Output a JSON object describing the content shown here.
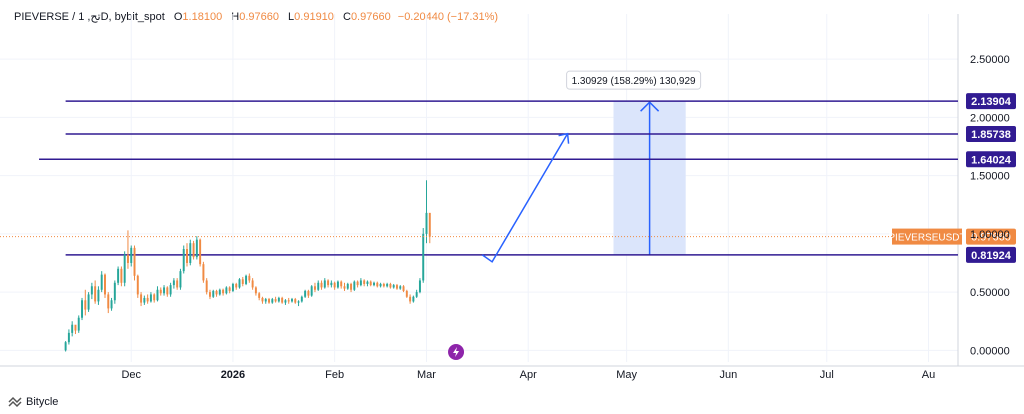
{
  "header": {
    "symbol": "PIEVERSE / 1 ,تحD, bybit_spot",
    "o_label": "O",
    "o_value": "1.18100",
    "h_label": "H",
    "h_value": "0.97660",
    "l_label": "L",
    "l_value": "0.91910",
    "c_label": "C",
    "c_value": "0.97660",
    "change": "−0.20440 (−17.31%)"
  },
  "footer": {
    "brand": "Bitycle"
  },
  "colors": {
    "up": "#26a69a",
    "down": "#f08a43",
    "level": "#311b92",
    "price_tag": "#f08a43",
    "range_fill": "#dbe5fb",
    "arrow": "#2962ff"
  },
  "chart_data": {
    "type": "candlestick",
    "ylim": [
      -0.1,
      2.75
    ],
    "y_ticks": [
      "0.00000",
      "0.50000",
      "1.00000",
      "1.50000",
      "2.00000",
      "2.50000"
    ],
    "y_tick_values": [
      0,
      0.5,
      1.0,
      1.5,
      2.0,
      2.5
    ],
    "x_ticks": [
      "Dec",
      "2026",
      "Feb",
      "Mar",
      "Apr",
      "May",
      "Jun",
      "Jul",
      "Au"
    ],
    "x_tick_days": [
      30,
      61,
      92,
      120,
      151,
      181,
      212,
      242,
      273
    ],
    "x_range_days": [
      -10,
      282
    ],
    "first_candle_day": 10,
    "candles": [
      [
        0.0,
        0.08,
        -0.01,
        0.07
      ],
      [
        0.07,
        0.18,
        0.05,
        0.15
      ],
      [
        0.15,
        0.25,
        0.12,
        0.22
      ],
      [
        0.22,
        0.2,
        0.14,
        0.17
      ],
      [
        0.17,
        0.3,
        0.15,
        0.28
      ],
      [
        0.28,
        0.45,
        0.26,
        0.43
      ],
      [
        0.43,
        0.52,
        0.3,
        0.35
      ],
      [
        0.35,
        0.5,
        0.33,
        0.48
      ],
      [
        0.48,
        0.58,
        0.44,
        0.55
      ],
      [
        0.55,
        0.6,
        0.4,
        0.42
      ],
      [
        0.42,
        0.55,
        0.39,
        0.52
      ],
      [
        0.52,
        0.68,
        0.5,
        0.65
      ],
      [
        0.65,
        0.66,
        0.45,
        0.48
      ],
      [
        0.48,
        0.5,
        0.32,
        0.36
      ],
      [
        0.36,
        0.45,
        0.34,
        0.43
      ],
      [
        0.43,
        0.6,
        0.4,
        0.58
      ],
      [
        0.58,
        0.72,
        0.56,
        0.7
      ],
      [
        0.7,
        0.72,
        0.55,
        0.58
      ],
      [
        0.58,
        0.85,
        0.55,
        0.82
      ],
      [
        0.82,
        1.03,
        0.7,
        0.75
      ],
      [
        0.75,
        0.9,
        0.72,
        0.88
      ],
      [
        0.88,
        0.9,
        0.6,
        0.64
      ],
      [
        0.64,
        0.65,
        0.45,
        0.48
      ],
      [
        0.48,
        0.5,
        0.38,
        0.41
      ],
      [
        0.41,
        0.47,
        0.39,
        0.45
      ],
      [
        0.45,
        0.48,
        0.4,
        0.42
      ],
      [
        0.42,
        0.5,
        0.41,
        0.48
      ],
      [
        0.48,
        0.49,
        0.41,
        0.43
      ],
      [
        0.43,
        0.55,
        0.42,
        0.52
      ],
      [
        0.52,
        0.54,
        0.47,
        0.49
      ],
      [
        0.49,
        0.56,
        0.47,
        0.54
      ],
      [
        0.54,
        0.55,
        0.46,
        0.48
      ],
      [
        0.48,
        0.58,
        0.46,
        0.56
      ],
      [
        0.56,
        0.62,
        0.53,
        0.6
      ],
      [
        0.6,
        0.62,
        0.52,
        0.54
      ],
      [
        0.54,
        0.7,
        0.52,
        0.68
      ],
      [
        0.68,
        0.9,
        0.66,
        0.87
      ],
      [
        0.87,
        0.92,
        0.72,
        0.75
      ],
      [
        0.75,
        0.95,
        0.73,
        0.92
      ],
      [
        0.92,
        0.94,
        0.78,
        0.8
      ],
      [
        0.8,
        0.98,
        0.78,
        0.95
      ],
      [
        0.95,
        0.96,
        0.72,
        0.74
      ],
      [
        0.74,
        0.76,
        0.58,
        0.6
      ],
      [
        0.6,
        0.62,
        0.48,
        0.5
      ],
      [
        0.5,
        0.52,
        0.44,
        0.46
      ],
      [
        0.46,
        0.52,
        0.45,
        0.51
      ],
      [
        0.51,
        0.52,
        0.46,
        0.48
      ],
      [
        0.48,
        0.53,
        0.47,
        0.52
      ],
      [
        0.52,
        0.53,
        0.47,
        0.49
      ],
      [
        0.49,
        0.55,
        0.48,
        0.54
      ],
      [
        0.54,
        0.55,
        0.49,
        0.51
      ],
      [
        0.51,
        0.58,
        0.5,
        0.57
      ],
      [
        0.57,
        0.58,
        0.52,
        0.54
      ],
      [
        0.54,
        0.62,
        0.53,
        0.61
      ],
      [
        0.61,
        0.63,
        0.55,
        0.57
      ],
      [
        0.57,
        0.65,
        0.56,
        0.64
      ],
      [
        0.64,
        0.66,
        0.58,
        0.6
      ],
      [
        0.6,
        0.62,
        0.52,
        0.54
      ],
      [
        0.54,
        0.55,
        0.47,
        0.49
      ],
      [
        0.49,
        0.5,
        0.43,
        0.45
      ],
      [
        0.45,
        0.46,
        0.4,
        0.42
      ],
      [
        0.42,
        0.45,
        0.4,
        0.44
      ],
      [
        0.44,
        0.45,
        0.4,
        0.41
      ],
      [
        0.41,
        0.45,
        0.4,
        0.44
      ],
      [
        0.44,
        0.46,
        0.41,
        0.42
      ],
      [
        0.42,
        0.46,
        0.41,
        0.45
      ],
      [
        0.45,
        0.46,
        0.4,
        0.41
      ],
      [
        0.41,
        0.44,
        0.39,
        0.43
      ],
      [
        0.43,
        0.45,
        0.4,
        0.42
      ],
      [
        0.42,
        0.45,
        0.41,
        0.44
      ],
      [
        0.44,
        0.45,
        0.4,
        0.41
      ],
      [
        0.41,
        0.43,
        0.38,
        0.42
      ],
      [
        0.42,
        0.47,
        0.41,
        0.46
      ],
      [
        0.46,
        0.52,
        0.45,
        0.51
      ],
      [
        0.51,
        0.52,
        0.45,
        0.47
      ],
      [
        0.47,
        0.56,
        0.46,
        0.55
      ],
      [
        0.55,
        0.58,
        0.5,
        0.52
      ],
      [
        0.52,
        0.6,
        0.51,
        0.58
      ],
      [
        0.58,
        0.6,
        0.52,
        0.54
      ],
      [
        0.54,
        0.62,
        0.53,
        0.6
      ],
      [
        0.6,
        0.61,
        0.54,
        0.56
      ],
      [
        0.56,
        0.6,
        0.54,
        0.58
      ],
      [
        0.58,
        0.59,
        0.52,
        0.54
      ],
      [
        0.54,
        0.6,
        0.53,
        0.59
      ],
      [
        0.59,
        0.6,
        0.53,
        0.55
      ],
      [
        0.55,
        0.58,
        0.51,
        0.53
      ],
      [
        0.53,
        0.58,
        0.52,
        0.57
      ],
      [
        0.57,
        0.58,
        0.5,
        0.52
      ],
      [
        0.52,
        0.6,
        0.51,
        0.59
      ],
      [
        0.59,
        0.6,
        0.54,
        0.56
      ],
      [
        0.56,
        0.62,
        0.55,
        0.6
      ],
      [
        0.6,
        0.61,
        0.55,
        0.57
      ],
      [
        0.57,
        0.6,
        0.55,
        0.59
      ],
      [
        0.59,
        0.6,
        0.55,
        0.56
      ],
      [
        0.56,
        0.59,
        0.55,
        0.58
      ],
      [
        0.58,
        0.59,
        0.54,
        0.55
      ],
      [
        0.55,
        0.58,
        0.54,
        0.57
      ],
      [
        0.57,
        0.58,
        0.54,
        0.55
      ],
      [
        0.55,
        0.58,
        0.54,
        0.57
      ],
      [
        0.57,
        0.58,
        0.53,
        0.54
      ],
      [
        0.54,
        0.57,
        0.53,
        0.56
      ],
      [
        0.56,
        0.57,
        0.52,
        0.53
      ],
      [
        0.53,
        0.56,
        0.52,
        0.55
      ],
      [
        0.55,
        0.56,
        0.5,
        0.51
      ],
      [
        0.51,
        0.52,
        0.45,
        0.46
      ],
      [
        0.46,
        0.48,
        0.4,
        0.42
      ],
      [
        0.42,
        0.47,
        0.41,
        0.46
      ],
      [
        0.46,
        0.52,
        0.45,
        0.5
      ],
      [
        0.5,
        0.62,
        0.49,
        0.6
      ],
      [
        0.6,
        1.05,
        0.58,
        1.0
      ],
      [
        1.0,
        1.46,
        0.92,
        1.18
      ],
      [
        1.18,
        1.18,
        0.92,
        0.9766
      ]
    ],
    "levels": [
      {
        "value": 2.13904,
        "label": "2.13904",
        "start_day": 0
      },
      {
        "value": 1.85738,
        "label": "1.85738",
        "start_day": 0
      },
      {
        "value": 1.64024,
        "label": "1.64024",
        "start_day": -2
      },
      {
        "value": 0.81924,
        "label": "0.81924",
        "start_day": 0
      }
    ],
    "current_price": {
      "value": 0.9766,
      "label": "0.97660",
      "symbol": "PIEVERSEUSDT"
    },
    "projection_path": [
      [
        137,
        0.82
      ],
      [
        140,
        0.76
      ],
      [
        163,
        1.86
      ]
    ],
    "measure": {
      "start_day": 177,
      "end_day": 199,
      "from": 0.82,
      "to": 2.13904,
      "label": "1.30929 (158.29%) 130,929"
    },
    "event_day": 129
  }
}
